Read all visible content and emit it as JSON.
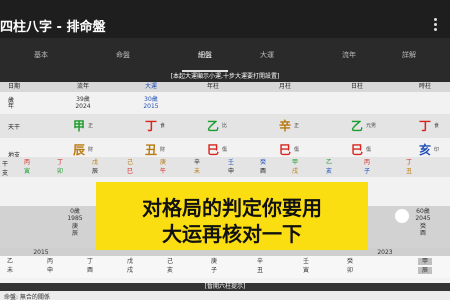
{
  "app": {
    "title": "四柱八字 - 排命盤"
  },
  "tabs": [
    "基本",
    "命盤",
    "細盤",
    "大運",
    "流年",
    "詳解"
  ],
  "active_tab": 2,
  "banner": "[本起大運顯示小運,十步大運要打開設置]",
  "headers": [
    "日期",
    "流年",
    "大運",
    "年柱",
    "月柱",
    "日柱",
    "時柱"
  ],
  "age_row": {
    "label": "歲年",
    "liunian": [
      "39歲",
      "2024"
    ],
    "dayun": [
      "30歲",
      "2015"
    ]
  },
  "tiangan": {
    "label": "天干",
    "items": [
      {
        "char": "甲",
        "color": "g",
        "note": "正"
      },
      {
        "char": "丁",
        "color": "r",
        "note": "食"
      },
      {
        "char": "乙",
        "color": "g",
        "note": "比"
      },
      {
        "char": "辛",
        "color": "o",
        "note": "正"
      },
      {
        "char": "乙",
        "color": "g",
        "note": "元男"
      },
      {
        "char": "丁",
        "color": "r",
        "note": "食"
      }
    ]
  },
  "dizhi": {
    "label": "地支",
    "items": [
      {
        "char": "辰",
        "color": "o",
        "note": "財"
      },
      {
        "char": "丑",
        "color": "o",
        "note": "財"
      },
      {
        "char": "巳",
        "color": "r",
        "note": "傷"
      },
      {
        "char": "巳",
        "color": "r",
        "note": "傷"
      },
      {
        "char": "巳",
        "color": "r",
        "note": "傷"
      },
      {
        "char": "亥",
        "color": "b",
        "note": "印"
      }
    ]
  },
  "small_rows": {
    "top": [
      {
        "char": "丙",
        "color": "r"
      },
      {
        "char": "丁",
        "color": "r"
      },
      {
        "char": "戊",
        "color": "o"
      },
      {
        "char": "己",
        "color": "o"
      },
      {
        "char": "庚",
        "color": "o"
      },
      {
        "char": "辛",
        "color": "k"
      },
      {
        "char": "壬",
        "color": "b"
      },
      {
        "char": "癸",
        "color": "b"
      },
      {
        "char": "甲",
        "color": "g"
      },
      {
        "char": "乙",
        "color": "g"
      },
      {
        "char": "丙",
        "color": "r"
      },
      {
        "char": "丁",
        "color": "r"
      }
    ],
    "bottom": [
      {
        "char": "寅",
        "color": "g"
      },
      {
        "char": "卯",
        "color": "g"
      },
      {
        "char": "辰",
        "color": "k"
      },
      {
        "char": "巳",
        "color": "r"
      },
      {
        "char": "午",
        "color": "r"
      },
      {
        "char": "未",
        "color": "o"
      },
      {
        "char": "申",
        "color": "k"
      },
      {
        "char": "酉",
        "color": "k"
      },
      {
        "char": "戌",
        "color": "o"
      },
      {
        "char": "亥",
        "color": "b"
      },
      {
        "char": "子",
        "color": "b"
      },
      {
        "char": "丑",
        "color": "o"
      }
    ],
    "side_labels": [
      "干",
      "支"
    ]
  },
  "dayun_row": {
    "left": [
      "0歲",
      "1985"
    ],
    "right": [
      "60歲",
      "2045"
    ],
    "left_gz": [
      "庚",
      "辰"
    ],
    "right_gz": [
      "癸",
      "酉"
    ]
  },
  "year_markers": [
    "2015",
    "2023"
  ],
  "bottom_gz": {
    "stems": [
      "乙",
      "丙",
      "丁",
      "戊",
      "己",
      "庚",
      "辛",
      "壬",
      "癸",
      "甲"
    ],
    "branches": [
      "未",
      "申",
      "酉",
      "戌",
      "亥",
      "子",
      "丑",
      "寅",
      "卯",
      "辰"
    ]
  },
  "overlay": {
    "line1": "对格局的判定你要用",
    "line2": "大运再核对一下"
  },
  "footer": {
    "bar": "[暫開六柱提示]",
    "text": "命盤: 無合的關係"
  },
  "colors": {
    "green": "#1c9c2c",
    "red": "#d6271f",
    "earth": "#b97a10",
    "water": "#1e4fb8",
    "overlay": "#fbde12"
  }
}
